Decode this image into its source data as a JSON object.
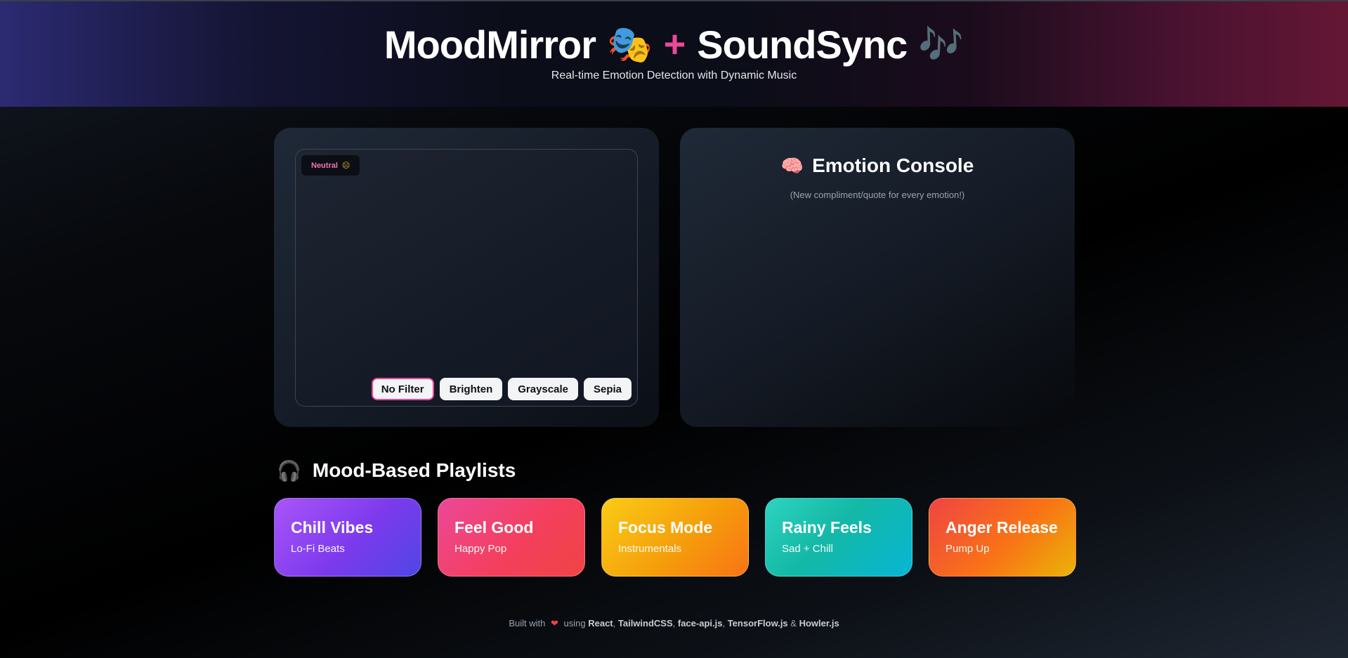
{
  "header": {
    "title_part1": "MoodMirror",
    "title_emoji1": "🎭",
    "plus": "+",
    "title_part2": "SoundSync",
    "title_emoji2": "🎶",
    "subtitle": "Real-time Emotion Detection with Dynamic Music"
  },
  "camera": {
    "emotion_label": "Neutral",
    "emotion_icon": "😐",
    "filters": [
      {
        "label": "No Filter",
        "active": true
      },
      {
        "label": "Brighten",
        "active": false
      },
      {
        "label": "Grayscale",
        "active": false
      },
      {
        "label": "Sepia",
        "active": false
      }
    ]
  },
  "console": {
    "icon": "🧠",
    "title": "Emotion Console",
    "subtitle": "(New compliment/quote for every emotion!)"
  },
  "playlists": {
    "icon": "🎧",
    "heading": "Mood-Based Playlists",
    "cards": [
      {
        "title": "Chill Vibes",
        "subtitle": "Lo-Fi Beats"
      },
      {
        "title": "Feel Good",
        "subtitle": "Happy Pop"
      },
      {
        "title": "Focus Mode",
        "subtitle": "Instrumentals"
      },
      {
        "title": "Rainy Feels",
        "subtitle": "Sad + Chill"
      },
      {
        "title": "Anger Release",
        "subtitle": "Pump Up"
      }
    ]
  },
  "footer": {
    "prefix": "Built with",
    "heart": "❤",
    "using": "using",
    "tech1": "React",
    "tech2": "TailwindCSS",
    "tech3": "face-api.js",
    "tech4": "TensorFlow.js",
    "amp": "&",
    "tech5": "Howler.js"
  },
  "colors": {
    "accent_pink": "#ec4899",
    "badge_text": "#f472b6"
  }
}
